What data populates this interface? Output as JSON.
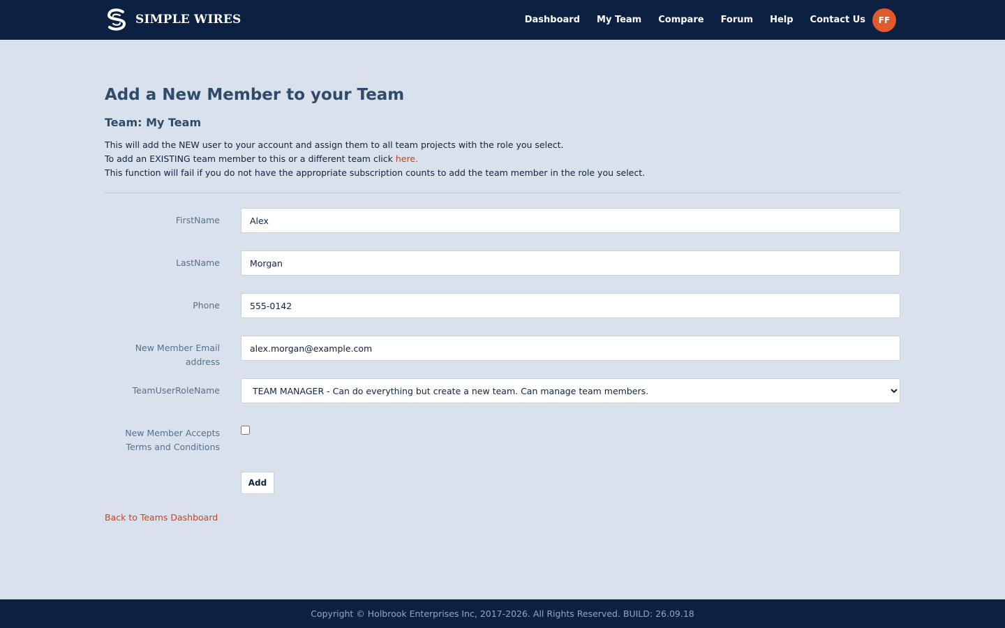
{
  "header": {
    "brand": "SIMPLE WIRES",
    "nav": [
      "Dashboard",
      "My Team",
      "Compare",
      "Forum",
      "Help",
      "Contact Us"
    ],
    "avatar_initials": "FF"
  },
  "main": {
    "title": "Add a New Member to your Team",
    "team_heading": "Team: My Team",
    "intro_line1": "This will add the NEW user to your account and assign them to all team projects with the role you select.",
    "intro_line2_prefix": "To add an EXISTING team member to this or a different team click ",
    "intro_line2_link": "here.",
    "intro_line3": "This function will fail if you do not have the appropriate subscription counts to add the team member in the role you select.",
    "form": {
      "first_name_label": "FirstName",
      "first_name_value": "Alex",
      "last_name_label": "LastName",
      "last_name_value": "Morgan",
      "phone_label": "Phone",
      "phone_value": "555-0142",
      "email_label": "New Member Email address",
      "email_value": "alex.morgan@example.com",
      "role_label": "TeamUserRoleName",
      "role_selected": "TEAM MANAGER - Can do everything but create a new team. Can manage team members.",
      "terms_label": "New Member Accepts Terms and Conditions",
      "terms_checked": false,
      "add_button": "Add"
    },
    "back_link": "Back to Teams Dashboard"
  },
  "footer": {
    "text": "Copyright © Holbrook Enterprises Inc, 2017-2026. All Rights Reserved. BUILD: 26.09.18"
  },
  "colors": {
    "navbar": "#0c2142",
    "background": "#d9e1ec",
    "accent": "#e25a2c",
    "link": "#c8431d"
  }
}
